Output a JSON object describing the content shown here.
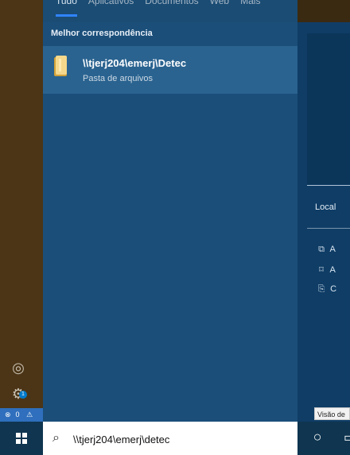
{
  "start": {
    "tabs": [
      "Tudo",
      "Aplicativos",
      "Documentos",
      "Web",
      "Mais"
    ],
    "best_match_label": "Melhor correspondência",
    "best_match": {
      "title": "\\\\tjerj204\\emerj\\Detec",
      "subtitle": "Pasta de arquivos"
    }
  },
  "right_panel": {
    "local_label": "Local",
    "items": [
      {
        "icon": "open-icon",
        "label": "A"
      },
      {
        "icon": "pin-icon",
        "label": "A"
      },
      {
        "icon": "copy-path-icon",
        "label": "C"
      }
    ]
  },
  "taskbar": {
    "search_value": "\\\\tjerj204\\emerj\\detec",
    "tooltip_text": "Visão de"
  },
  "left_status": {
    "errors": "0",
    "warnings": ""
  },
  "badges": {
    "settings_count": "1"
  }
}
